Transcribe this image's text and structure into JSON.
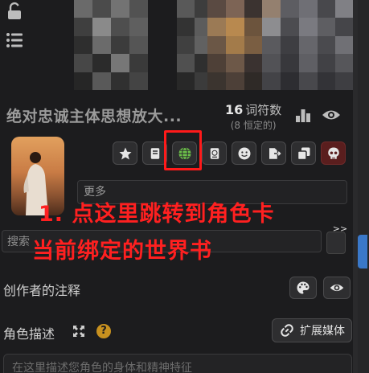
{
  "character": {
    "name": "绝对忠诚主体思想放大...",
    "token_count": "16",
    "token_label": "词符数",
    "token_permanent": "(8 恒定的)"
  },
  "toolbar": {
    "icons": [
      "star-icon",
      "book-icon",
      "globe-icon",
      "passport-icon",
      "smiley-icon",
      "export-icon",
      "duplicate-icon",
      "skull-icon"
    ]
  },
  "fields": {
    "name_label": "更多",
    "search_placeholder": "搜索",
    "chevron": ">>"
  },
  "annotations": {
    "line1": "1. 点这里跳转到角色卡",
    "line2": "当前绑定的世界书"
  },
  "sections": {
    "creator_notes": "创作者的注释",
    "char_description": "角色描述",
    "help": "?",
    "expand_media": "扩展媒体",
    "desc_placeholder": "在这里描述您角色的身体和精神特征"
  },
  "colors": {
    "background": "#1c1c1e",
    "annotation": "#ff2020",
    "globe_green": "#6cbf4a",
    "danger": "#5a1e1e",
    "scroll_accent": "#3a78c9"
  }
}
